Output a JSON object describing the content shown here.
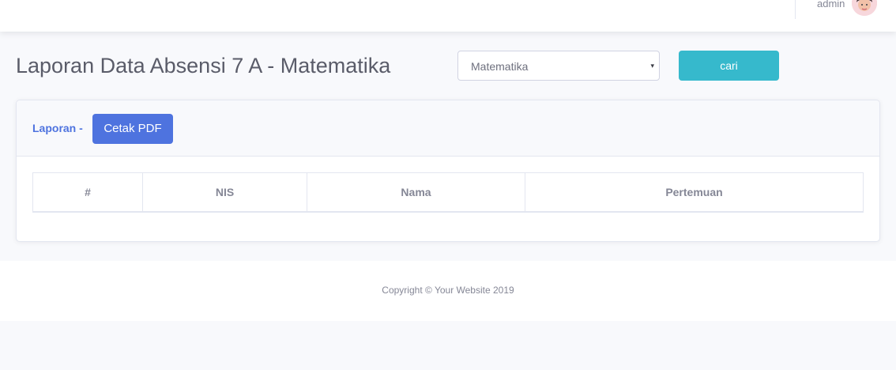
{
  "topbar": {
    "user_name": "admin"
  },
  "heading": {
    "title": "Laporan Data Absensi 7 A - Matematika"
  },
  "filter": {
    "subject_selected": "Matematika",
    "caret": "▾",
    "search_label": "cari"
  },
  "card": {
    "header_label": "Laporan -",
    "pdf_button_label": "Cetak PDF",
    "table": {
      "columns": [
        "#",
        "NIS",
        "Nama",
        "Pertemuan"
      ]
    }
  },
  "footer": {
    "copyright": "Copyright © Your Website 2019"
  },
  "colors": {
    "primary": "#4e73df",
    "info": "#36b9cc",
    "background": "#f8f9fc"
  }
}
